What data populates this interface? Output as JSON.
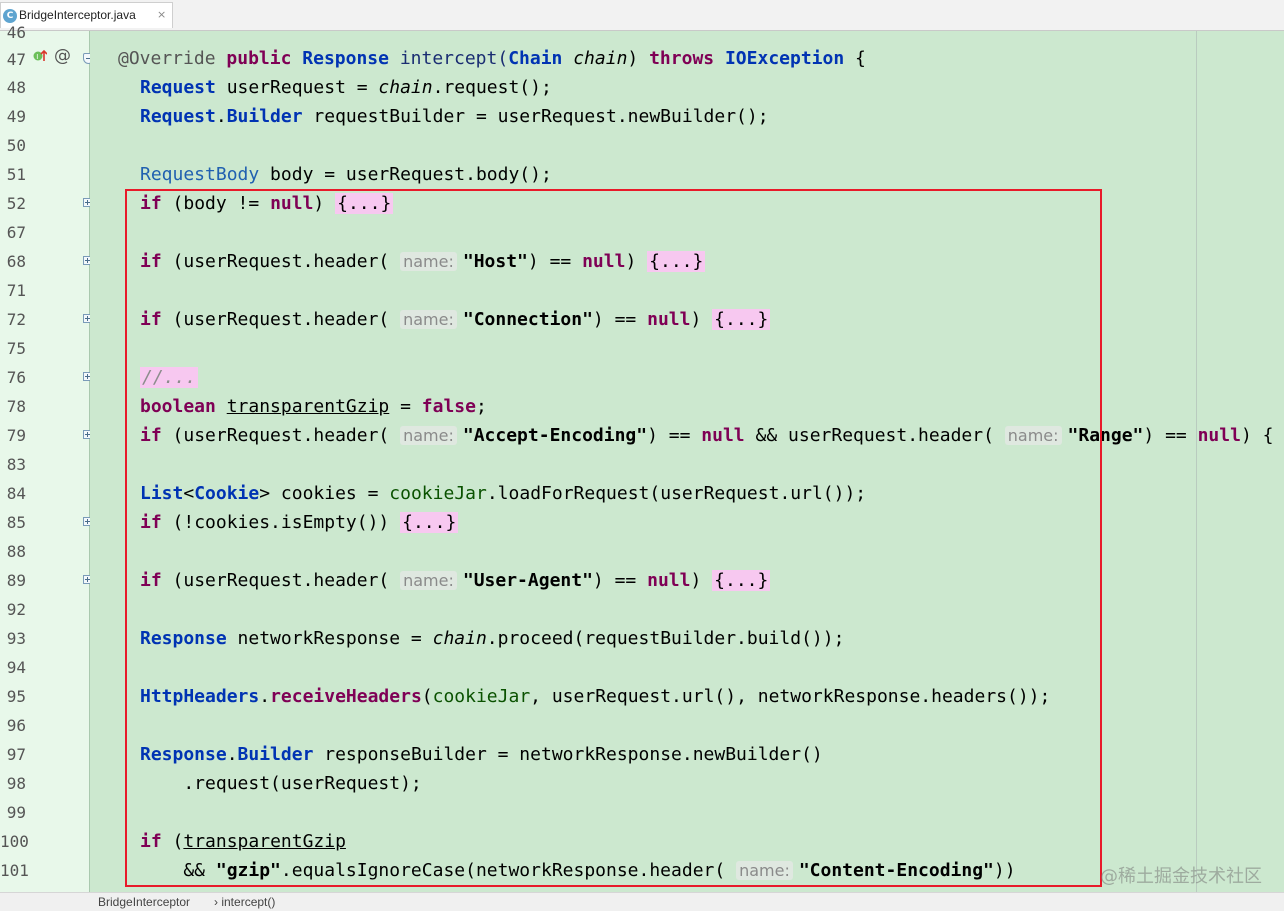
{
  "tab": {
    "file_name": "BridgeInterceptor.java",
    "icon": "java-class-icon",
    "close": "×"
  },
  "gutter": {
    "line_numbers": [
      "46",
      "47",
      "48",
      "49",
      "50",
      "51",
      "52",
      "67",
      "68",
      "71",
      "72",
      "75",
      "76",
      "78",
      "79",
      "83",
      "84",
      "85",
      "88",
      "89",
      "92",
      "93",
      "94",
      "95",
      "96",
      "97",
      "98",
      "99",
      "100",
      "101"
    ]
  },
  "code": {
    "l47_annotation": "@Override",
    "l47_public": "public",
    "l47_type": "Response",
    "l47_method": "intercept(",
    "l47_param_type": "Chain",
    "l47_param": "chain",
    "l47_throws": "throws",
    "l47_exc": "IOException",
    "l47_brace": "{",
    "l48_type": "Request",
    "l48_rest1": " userRequest = ",
    "l48_chain": "chain",
    "l48_rest2": ".request();",
    "l49_type": "Request",
    "l49_dot": ".",
    "l49_builder": "Builder",
    "l49_rest": " requestBuilder = userRequest.newBuilder();",
    "l51_type": "RequestBody",
    "l51_rest": " body = userRequest.body();",
    "l52_if": "if",
    "l52_cond": " (body != ",
    "l52_null": "null",
    "l52_close": ") ",
    "l52_fold": "{...}",
    "l68_if": "if",
    "l68_a": " (userRequest.header(",
    "l68_hint": "name:",
    "l68_str": "\"Host\"",
    "l68_b": ") == ",
    "l68_null": "null",
    "l68_c": ") ",
    "l68_fold": "{...}",
    "l72_if": "if",
    "l72_a": " (userRequest.header(",
    "l72_hint": "name:",
    "l72_str": "\"Connection\"",
    "l72_b": ") == ",
    "l72_null": "null",
    "l72_c": ") ",
    "l72_fold": "{...}",
    "l76_comment": "//...",
    "l78_bool": "boolean",
    "l78_var": "transparentGzip",
    "l78_eq": " = ",
    "l78_false": "false",
    "l78_semi": ";",
    "l79_if": "if",
    "l79_a": " (userRequest.header(",
    "l79_hint1": "name:",
    "l79_str1": "\"Accept-Encoding\"",
    "l79_b": ") == ",
    "l79_null1": "null",
    "l79_and": " && ",
    "l79_c": "userRequest.header(",
    "l79_hint2": "name:",
    "l79_str2": "\"Range\"",
    "l79_d": ") == ",
    "l79_null2": "null",
    "l79_e": ") {",
    "l84_list": "List",
    "l84_lt": "<",
    "l84_cookie": "Cookie",
    "l84_gt": ">",
    "l84_a": " cookies = ",
    "l84_jar": "cookieJar",
    "l84_b": ".loadForRequest(userRequest.url());",
    "l85_if": "if",
    "l85_a": " (!cookies.isEmpty()) ",
    "l85_fold": "{...}",
    "l89_if": "if",
    "l89_a": " (userRequest.header(",
    "l89_hint": "name:",
    "l89_str": "\"User-Agent\"",
    "l89_b": ") == ",
    "l89_null": "null",
    "l89_c": ") ",
    "l89_fold": "{...}",
    "l93_type": "Response",
    "l93_a": " networkResponse = ",
    "l93_chain": "chain",
    "l93_b": ".proceed(requestBuilder.build());",
    "l95_cls": "HttpHeaders",
    "l95_dot": ".",
    "l95_m": "receiveHeaders",
    "l95_a": "(",
    "l95_jar": "cookieJar",
    "l95_b": ", userRequest.url(), networkResponse.headers());",
    "l97_type": "Response",
    "l97_dot": ".",
    "l97_builder": "Builder",
    "l97_rest": " responseBuilder = networkResponse.newBuilder()",
    "l98": "    .request(userRequest);",
    "l100_if": "if",
    "l100_a": " (",
    "l100_var": "transparentGzip",
    "l101_a": "    && ",
    "l101_str": "\"gzip\"",
    "l101_b": ".equalsIgnoreCase(networkResponse.header(",
    "l101_hint": "name:",
    "l101_str2": "\"Content-Encoding\"",
    "l101_c": "))"
  },
  "statusbar": {
    "crumb_class": "BridgeInterceptor",
    "sep": "›",
    "crumb_method": "intercept()"
  },
  "watermark": "@稀土掘金技术社区",
  "colors": {
    "editor_bg": "#cce8cf",
    "caret_row": "#a7c2de",
    "highlight_box": "#e81a2a",
    "keyword": "#7f0055",
    "type": "#0033b3"
  }
}
